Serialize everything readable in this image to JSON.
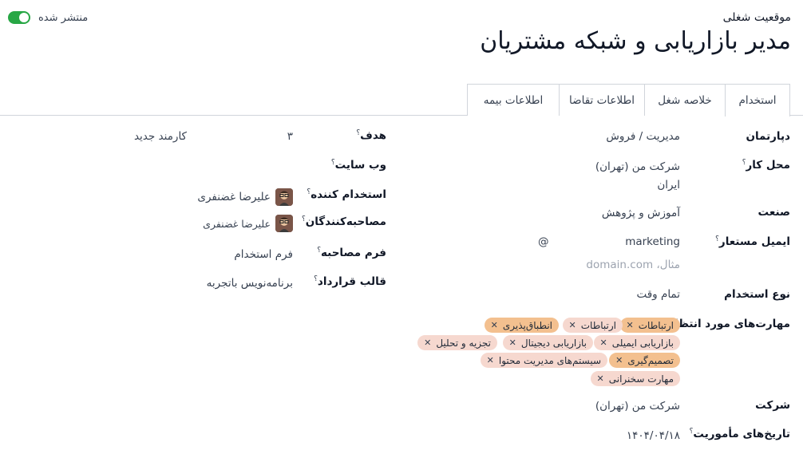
{
  "header": {
    "subtitle": "موقعیت شغلی",
    "title": "مدیر بازاریابی و شبکه مشتریان",
    "published_label": "منتشر شده"
  },
  "tabs": [
    {
      "label": "استخدام"
    },
    {
      "label": "خلاصه شغل"
    },
    {
      "label": "اطلاعات تقاضا"
    },
    {
      "label": "اطلاعات بیمه"
    }
  ],
  "right": {
    "department_label": "دپارتمان",
    "department_value": "مدیریت / فروش",
    "location_label": "محل کار",
    "location_line1": "شرکت من (تهران)",
    "location_line2": "ایران",
    "industry_label": "صنعت",
    "industry_value": "آموزش و پژوهش",
    "alias_label": "ایمیل مستعار",
    "alias_value": "marketing",
    "alias_at": "@",
    "alias_domain_placeholder": "مثال، domain.com",
    "employment_type_label": "نوع استخدام",
    "employment_type_value": "تمام وقت",
    "skills_label": "مهارت‌های مورد انتظار",
    "skills": [
      {
        "label": "ارتباطات",
        "color": "#f3c08f"
      },
      {
        "label": "ارتباطات",
        "color": "#f6d8cf"
      },
      {
        "label": "انطباق‌پذیری",
        "color": "#f3c08f"
      },
      {
        "label": "بازاریابی ایمیلی",
        "color": "#f6d8cf"
      },
      {
        "label": "بازاریابی دیجیتال",
        "color": "#f6d8cf"
      },
      {
        "label": "تجزیه و تحلیل",
        "color": "#f6d8cf"
      },
      {
        "label": "تصمیم‌گیری",
        "color": "#f3c08f"
      },
      {
        "label": "سیستم‌های مدیریت محتوا",
        "color": "#f6d8cf"
      },
      {
        "label": "مهارت سخنرانی",
        "color": "#f6d8cf"
      }
    ],
    "company_label": "شرکت",
    "company_value": "شرکت من (تهران)",
    "mission_dates_label": "تاریخ‌های مأموریت",
    "mission_dates_value": "۱۴۰۴/۰۴/۱۸"
  },
  "left": {
    "target_label": "هدف",
    "target_value": "۳",
    "target_unit": "کارمند جدید",
    "website_label": "وب سایت",
    "recruiter_label": "استخدام کننده",
    "recruiter_value": "علیرضا غضنفری",
    "interviewers_label": "مصاحبه‌کنندگان",
    "interviewers_value": "علیرضا غضنفری",
    "interview_form_label": "فرم مصاحبه",
    "interview_form_value": "فرم استخدام",
    "contract_template_label": "قالب قرارداد",
    "contract_template_value": "برنامه‌نویس باتجربه"
  },
  "help_mark": "؟"
}
